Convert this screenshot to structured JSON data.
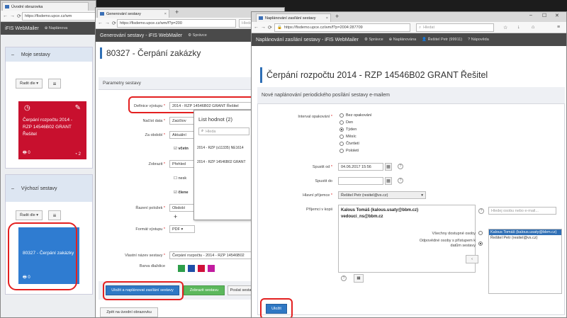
{
  "win1": {
    "tab_title": "Úvodní obrazovka",
    "url": "https://fisdemo.upce.cz/wm",
    "brand": "iFIS WebMailer",
    "nav_item": "Naplánova",
    "my_reports": {
      "header": "Moje sestavy",
      "sort_label": "Řadit dle",
      "card_title": "Čerpání rozpočtu 2014 - RZP 14546B02 GRANT Řešitel",
      "print_count": "0",
      "time_count": "2"
    },
    "default_reports": {
      "header": "Výchozí sestavy",
      "sort_label": "Řadit dle",
      "card_title": "80327 - Čerpání zakázky",
      "print_count": "0"
    }
  },
  "win2": {
    "tab_title": "Generování sestavy",
    "url": "https://fisdemo.upce.cz/wm/f?p=200",
    "search_placeholder": "Hleda",
    "brand": "Generování sestavy - iFIS WebMailer",
    "nav_item": "Správce",
    "page_title": "80327 - Čerpání zakázky",
    "params_header": "Parametry sestavy",
    "labels": {
      "definice": "Definice výstupu",
      "nacist": "Načíst data",
      "za_obdobi": "Za období",
      "zobrazit": "Zobrazit",
      "razeni": "Řazení položek",
      "format": "Formát výstupu",
      "vlastni_nazev": "Vlastní název sestavy",
      "barva": "Barva dlaždice"
    },
    "values": {
      "definice": "2014 - RZP 14546B02 GRANT Řešitel",
      "nacist": "Zaúčtov",
      "za_obdobi": "Aktuální",
      "vcetne": "včetn",
      "prehled": "Přehled",
      "nesk": "nesk",
      "cleneni": "člene",
      "razeni": "Období",
      "format": "PDF",
      "vlastni_nazev": "Čerpání rozpočtu - 2014 - RZP 14546B02"
    },
    "colors": [
      "#2e9e4a",
      "#1f4fa8",
      "#d0103a",
      "#c21ca0"
    ],
    "buttons": {
      "save_schedule": "Uložit a naplánovat zasílání sestavy",
      "show": "Zobrazit sestavu",
      "send": "Poslat sestav",
      "back": "Zpět na úvodní obrazovku"
    },
    "popup": {
      "title": "List hodnot (2)",
      "search_placeholder": "Hleda",
      "items": [
        "2014 - RZP (s11335) NE1614",
        "2014 - RZP 14546B02 GRANT"
      ]
    }
  },
  "win3": {
    "tab_title": "Naplánování zasílání sestavy",
    "url": "https://fisdemo.upce.cz/wm/f?p=2004:287709",
    "search_placeholder": "Hledat",
    "brand": "Naplánování zasílání sestavy - iFIS WebMailer",
    "nav_items": [
      "Správce",
      "Naplánována",
      "Řešitel Petr (99911)",
      "Nápověda"
    ],
    "page_title": "Čerpání rozpočtu 2014 - RZP 14546B02 GRANT Řešitel",
    "panel_header": "Nové naplánování periodického posílání sestavy e-mailem",
    "interval_label": "Interval opakování",
    "interval_options": [
      "Bez opakování",
      "Den",
      "Týden",
      "Měsíc",
      "Čtvrtletí",
      "Pololetí"
    ],
    "interval_selected": 2,
    "start_label": "Spustit od",
    "start_value": "04.06.2017 15:56",
    "end_label": "Spustit do",
    "main_recipient_label": "Hlavní příjemce",
    "main_recipient_value": "Řešitel Petr (resitel@vs.cz)",
    "cc_label": "Příjemci v kopii",
    "cc_values": [
      "Kalous Tomáš (kalous.usaty@bbm.cz)",
      "vedouci_ns@bbm.cz"
    ],
    "search_person_placeholder": "Hledej osobu nebo e-mail...",
    "access_all": "Všechny dostupné osoby",
    "access_rights": "Odpovědné osoby s přístupem k datům sestavy",
    "person_list": [
      "Kalous Tomáš (kalous.usaty@bbm.cz)",
      "Řešitel Petr (resitel@vs.cz)"
    ],
    "save_button": "Uložit"
  }
}
